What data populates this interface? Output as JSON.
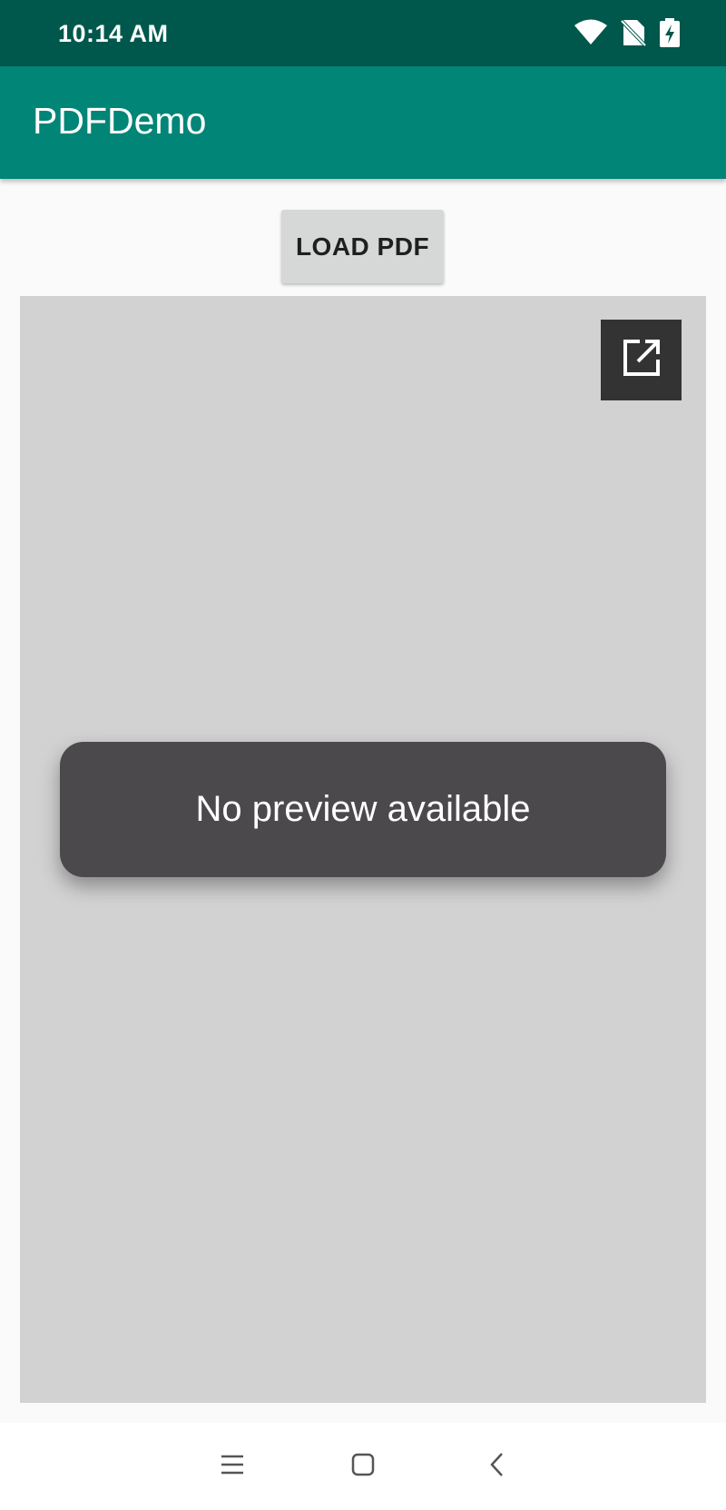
{
  "status_bar": {
    "time": "10:14 AM",
    "icons": [
      "wifi-icon",
      "no-sim-icon",
      "battery-charging-icon"
    ]
  },
  "app_bar": {
    "title": "PDFDemo"
  },
  "main": {
    "load_button_label": "LOAD PDF",
    "open_external_icon": "open-in-new-icon",
    "toast_message": "No preview available"
  },
  "nav_bar": {
    "buttons": [
      "menu-icon",
      "home-icon",
      "back-icon"
    ]
  },
  "colors": {
    "status_bar": "#00574b",
    "app_bar": "#008577",
    "button_bg": "#d6d7d7",
    "pdf_area_bg": "#d2d2d2",
    "toast_bg": "#4b494c",
    "open_icon_bg": "#333333"
  }
}
